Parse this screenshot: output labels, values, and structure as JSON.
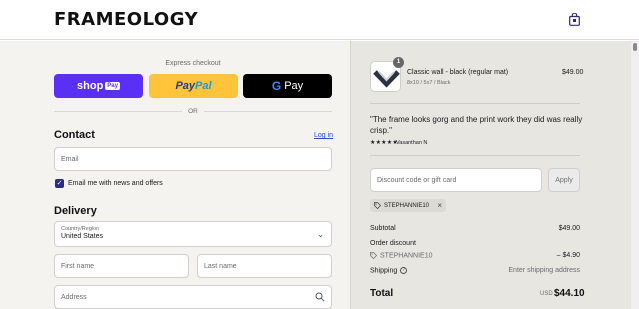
{
  "header": {
    "logo": "FRAMEOLOGY",
    "cart_icon": "shopping-bag-icon"
  },
  "express": {
    "label": "Express checkout",
    "shop_pay": {
      "text": "shop",
      "pill": "Pay"
    },
    "paypal": {
      "pay": "Pay",
      "pal": "Pal"
    },
    "gpay": {
      "g": "G",
      "text": "Pay"
    },
    "or_label": "OR"
  },
  "contact": {
    "title": "Contact",
    "login_link": "Log in",
    "email_placeholder": "Email",
    "newsletter_label": "Email me with news and offers",
    "newsletter_checked": true
  },
  "delivery": {
    "title": "Delivery",
    "country_label": "Country/Region",
    "country_value": "United States",
    "first_name_placeholder": "First name",
    "last_name_placeholder": "Last name",
    "address_placeholder": "Address"
  },
  "order": {
    "product": {
      "name": "Classic wall - black (regular mat)",
      "variant": "8x10 / 5x7 / Black",
      "price": "$49.00",
      "quantity": "1"
    },
    "review": {
      "quote": "\"The frame looks gorg and the print work they did was really crisp.\"",
      "stars": "★★★★★",
      "rating": 5,
      "reviewer": "Vasanthan N"
    },
    "discount": {
      "placeholder": "Discount code or gift card",
      "apply_label": "Apply",
      "applied_code": "STEPHANNIE10"
    },
    "summary": {
      "subtotal_label": "Subtotal",
      "subtotal_value": "$49.00",
      "order_discount_label": "Order discount",
      "discount_code": "STEPHANNIE10",
      "discount_value": "– $4.90",
      "shipping_label": "Shipping",
      "shipping_value": "Enter shipping address",
      "total_label": "Total",
      "total_currency": "USD",
      "total_value": "$44.10"
    }
  },
  "colors": {
    "shop_pay": "#5a31f4",
    "paypal": "#ffc439",
    "gpay": "#000000",
    "link": "#1d4ed8",
    "checkbox": "#2b2a86",
    "summary_bg": "#e8e6e1"
  }
}
